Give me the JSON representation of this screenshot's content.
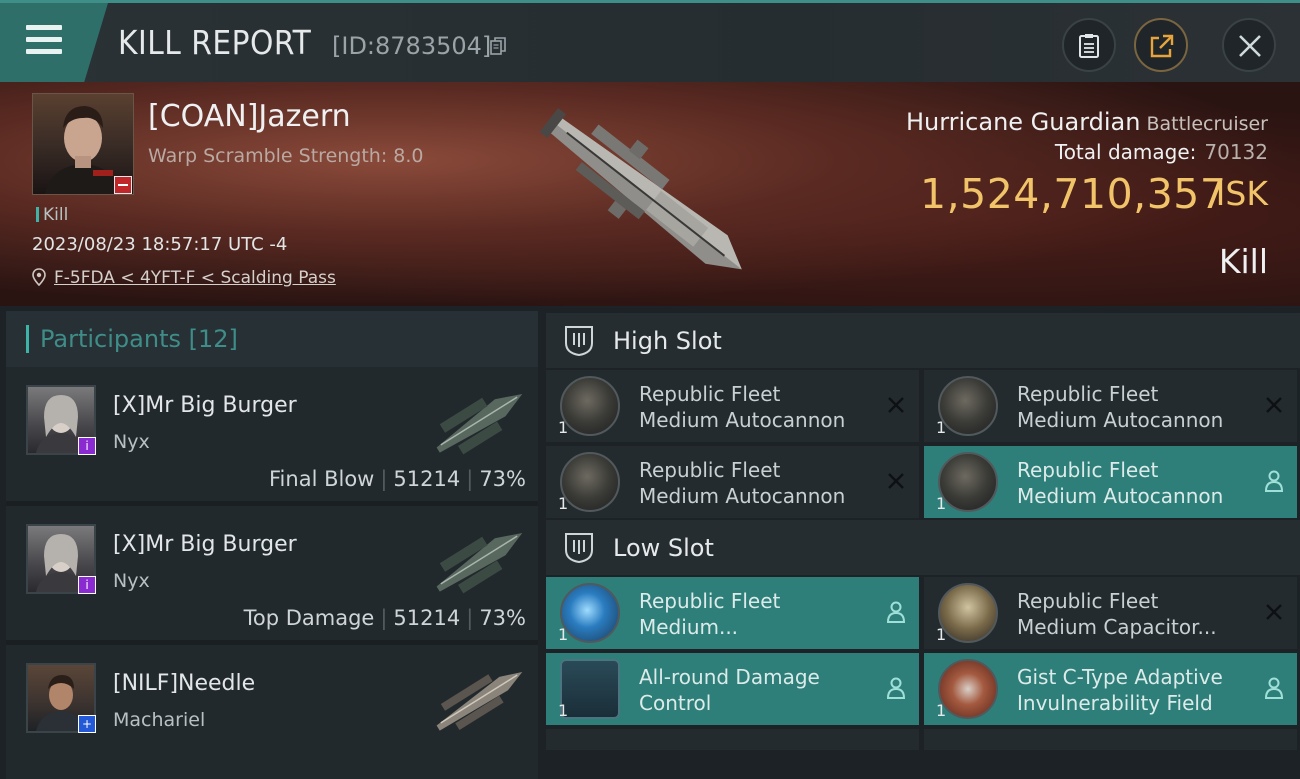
{
  "header": {
    "title": "KILL REPORT",
    "report_id": "[ID:8783504]",
    "icons": [
      "menu-icon",
      "copy-icon",
      "clipboard-icon",
      "share-icon",
      "close-icon"
    ]
  },
  "victim": {
    "name": "[COAN]Jazern",
    "warp_scramble": "Warp Scramble Strength: 8.0",
    "kill_tag": "Kill",
    "datetime": "2023/08/23 18:57:17 UTC -4",
    "location": "F-5FDA < 4YFT-F < Scalding Pass",
    "ship_name": "Hurricane Guardian",
    "ship_class": "Battlecruiser",
    "total_damage_label": "Total damage:",
    "total_damage": "70132",
    "isk_value": "1,524,710,357",
    "isk_unit": "ISK",
    "result": "Kill"
  },
  "participants": {
    "label": "Participants [12]",
    "rows": [
      {
        "name": "[X]Mr Big Burger",
        "ship": "Nyx",
        "role": "Final Blow",
        "damage": "51214",
        "percent": "73%"
      },
      {
        "name": "[X]Mr Big Burger",
        "ship": "Nyx",
        "role": "Top Damage",
        "damage": "51214",
        "percent": "73%"
      },
      {
        "name": "[NILF]Needle",
        "ship": "Machariel",
        "role": "",
        "damage": "",
        "percent": ""
      }
    ]
  },
  "high_slot": {
    "title": "High Slot",
    "modules": [
      {
        "line1": "Republic Fleet",
        "line2": "Medium Autocannon",
        "qty": "1"
      },
      {
        "line1": "Republic Fleet",
        "line2": "Medium Autocannon",
        "qty": "1"
      },
      {
        "line1": "Republic Fleet",
        "line2": "Medium Autocannon",
        "qty": "1"
      },
      {
        "line1": "Republic Fleet",
        "line2": "Medium Autocannon",
        "qty": "1"
      }
    ]
  },
  "low_slot": {
    "title": "Low Slot",
    "modules": [
      {
        "line1": "Republic Fleet",
        "line2": "Medium...",
        "qty": "1"
      },
      {
        "line1": "Republic Fleet",
        "line2": "Medium Capacitor...",
        "qty": "1"
      },
      {
        "line1": "All-round Damage",
        "line2": "Control",
        "qty": "1"
      },
      {
        "line1": "Gist C-Type Adaptive",
        "line2": "Invulnerability Field",
        "qty": "1"
      }
    ]
  },
  "colors": {
    "accent_teal": "#3fb3a8",
    "isk_gold": "#f2c46a",
    "dropped_module_bg": "#2e7f79",
    "destroyed_module_bg": "#242b2f"
  }
}
